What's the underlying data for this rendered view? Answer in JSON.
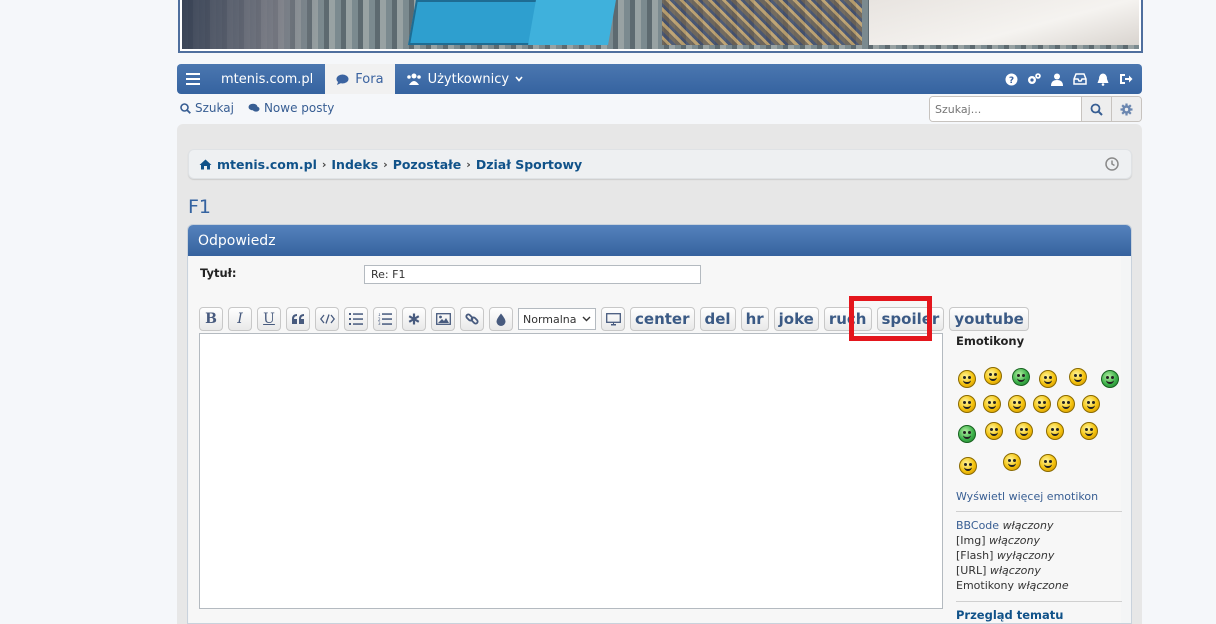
{
  "navbar": {
    "site": "mtenis.com.pl",
    "forums": "Fora",
    "users": "Użytkownicy"
  },
  "subnav": {
    "search": "Szukaj",
    "new_posts": "Nowe posty",
    "search_placeholder": "Szukaj..."
  },
  "breadcrumbs": [
    "mtenis.com.pl",
    "Indeks",
    "Pozostałe",
    "Dział Sportowy"
  ],
  "topic_title": "F1",
  "reply_panel": {
    "heading": "Odpowiedz",
    "title_label": "Tytuł:",
    "title_value": "Re: F1"
  },
  "toolbar": {
    "bold": "B",
    "italic": "I",
    "underline": "U",
    "font_size": "Normalna",
    "custom_buttons": [
      "center",
      "del",
      "hr",
      "joke",
      "ruch",
      "spoiler",
      "youtube"
    ]
  },
  "sidebar": {
    "emoticons_heading": "Emotikony",
    "more_emoticons": "Wyświetl więcej emotikon",
    "bbcode_label": "BBCode",
    "bbcode_state": "włączony",
    "img_label": "[Img]",
    "img_state": "włączony",
    "flash_label": "[Flash]",
    "flash_state": "wyłączony",
    "url_label": "[URL]",
    "url_state": "włączony",
    "emoticons_label": "Emotikony",
    "emoticons_state": "włączone",
    "topic_review": "Przegląd tematu"
  },
  "colors": {
    "accent": "#3563a0",
    "highlight": "#e4161d"
  }
}
